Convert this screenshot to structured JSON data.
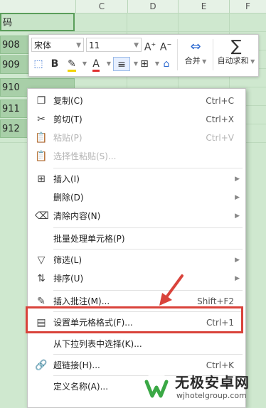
{
  "sheet": {
    "columns": [
      "C",
      "D",
      "E",
      "F"
    ],
    "a1_text": "码",
    "cells": [
      "908",
      "909",
      "910",
      "911",
      "912"
    ]
  },
  "toolbar": {
    "font_name": "宋体",
    "font_size": "11",
    "bold": "B",
    "text_color_letter": "A",
    "merge_label": "合并",
    "autosum_label": "自动求和"
  },
  "menu": {
    "items": [
      {
        "label": "复制(C)",
        "shortcut": "Ctrl+C",
        "icon": "copy-icon"
      },
      {
        "label": "剪切(T)",
        "shortcut": "Ctrl+X",
        "icon": "scissors-icon"
      },
      {
        "label": "粘贴(P)",
        "shortcut": "Ctrl+V",
        "icon": "paste-icon",
        "disabled": true
      },
      {
        "label": "选择性粘贴(S)...",
        "shortcut": "",
        "icon": "paste-special-icon",
        "disabled": true
      },
      {
        "label": "插入(I)",
        "shortcut": "",
        "icon": "insert-icon"
      },
      {
        "label": "删除(D)",
        "shortcut": "",
        "icon": ""
      },
      {
        "label": "清除内容(N)",
        "shortcut": "",
        "icon": "eraser-icon"
      },
      {
        "label": "批量处理单元格(P)",
        "shortcut": "",
        "icon": ""
      },
      {
        "label": "筛选(L)",
        "shortcut": "",
        "icon": "filter-icon"
      },
      {
        "label": "排序(U)",
        "shortcut": "",
        "icon": "sort-icon"
      },
      {
        "label": "插入批注(M)...",
        "shortcut": "Shift+F2",
        "icon": "comment-icon"
      },
      {
        "label": "设置单元格格式(F)...",
        "shortcut": "Ctrl+1",
        "icon": "format-cells-icon"
      },
      {
        "label": "从下拉列表中选择(K)...",
        "shortcut": "",
        "icon": ""
      },
      {
        "label": "超链接(H)...",
        "shortcut": "Ctrl+K",
        "icon": "link-icon"
      },
      {
        "label": "定义名称(A)...",
        "shortcut": "",
        "icon": ""
      }
    ]
  },
  "watermark": {
    "title": "无极安卓网",
    "url": "wjhotelgroup.com"
  },
  "colors": {
    "selection_green": "#a8cfa8",
    "highlight_red": "#d9433b",
    "accent_blue": "#2f6bd0"
  }
}
